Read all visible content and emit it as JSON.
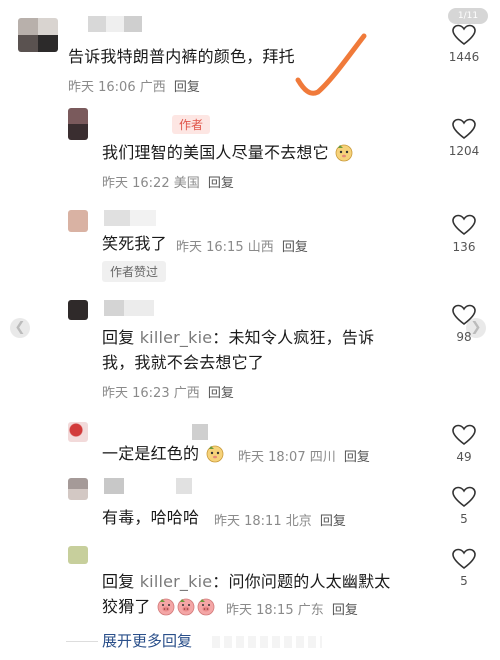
{
  "page_indicator": "1/11",
  "comments": [
    {
      "text_main": "告诉我特朗普内裤的颜色，拜托",
      "meta_time": "昨天 16:06",
      "meta_loc": "广西",
      "reply": "回复",
      "likes": "1446"
    },
    {
      "tag": "作者",
      "text_main": "我们理智的美国人尽量不去想它",
      "meta_time": "昨天 16:22",
      "meta_loc": "美国",
      "reply": "回复",
      "likes": "1204"
    },
    {
      "text_main": "笑死我了",
      "meta_time": "昨天 16:15",
      "meta_loc": "山西",
      "reply": "回复",
      "badge": "作者赞过",
      "likes": "136"
    },
    {
      "text_prefix": "回复",
      "text_user": "killer_kie",
      "text_colon": "：",
      "text_line1": "未知令人疯狂，告诉",
      "text_line2": "我，我就不会去想它了",
      "meta_time": "昨天 16:23",
      "meta_loc": "广西",
      "reply": "回复",
      "likes": "98"
    },
    {
      "text_main": "一定是红色的",
      "meta_time": "昨天 18:07",
      "meta_loc": "四川",
      "reply": "回复",
      "likes": "49"
    },
    {
      "text_main": "有毒，哈哈哈",
      "meta_time": "昨天 18:11",
      "meta_loc": "北京",
      "reply": "回复",
      "likes": "5"
    },
    {
      "text_prefix": "回复",
      "text_user": "killer_kie",
      "text_colon": "：",
      "text_line1": "问你问题的人太幽默太",
      "text_line2": "狡猾了",
      "meta_time": "昨天 18:15",
      "meta_loc": "广东",
      "reply": "回复",
      "likes": "5"
    }
  ],
  "more_replies": "展开更多回复",
  "colors": {
    "annotation_check": "#f07a3a",
    "author_tag_bg": "#fde6e3",
    "author_tag_text": "#e0554a",
    "link_blue": "#2a4f8a"
  },
  "icons": {
    "like": "heart-outline-icon",
    "emoji": "cute-face-emoji-icon",
    "pig": "pig-face-emoji-icon",
    "prev": "chevron-left-icon",
    "next": "chevron-right-icon"
  }
}
